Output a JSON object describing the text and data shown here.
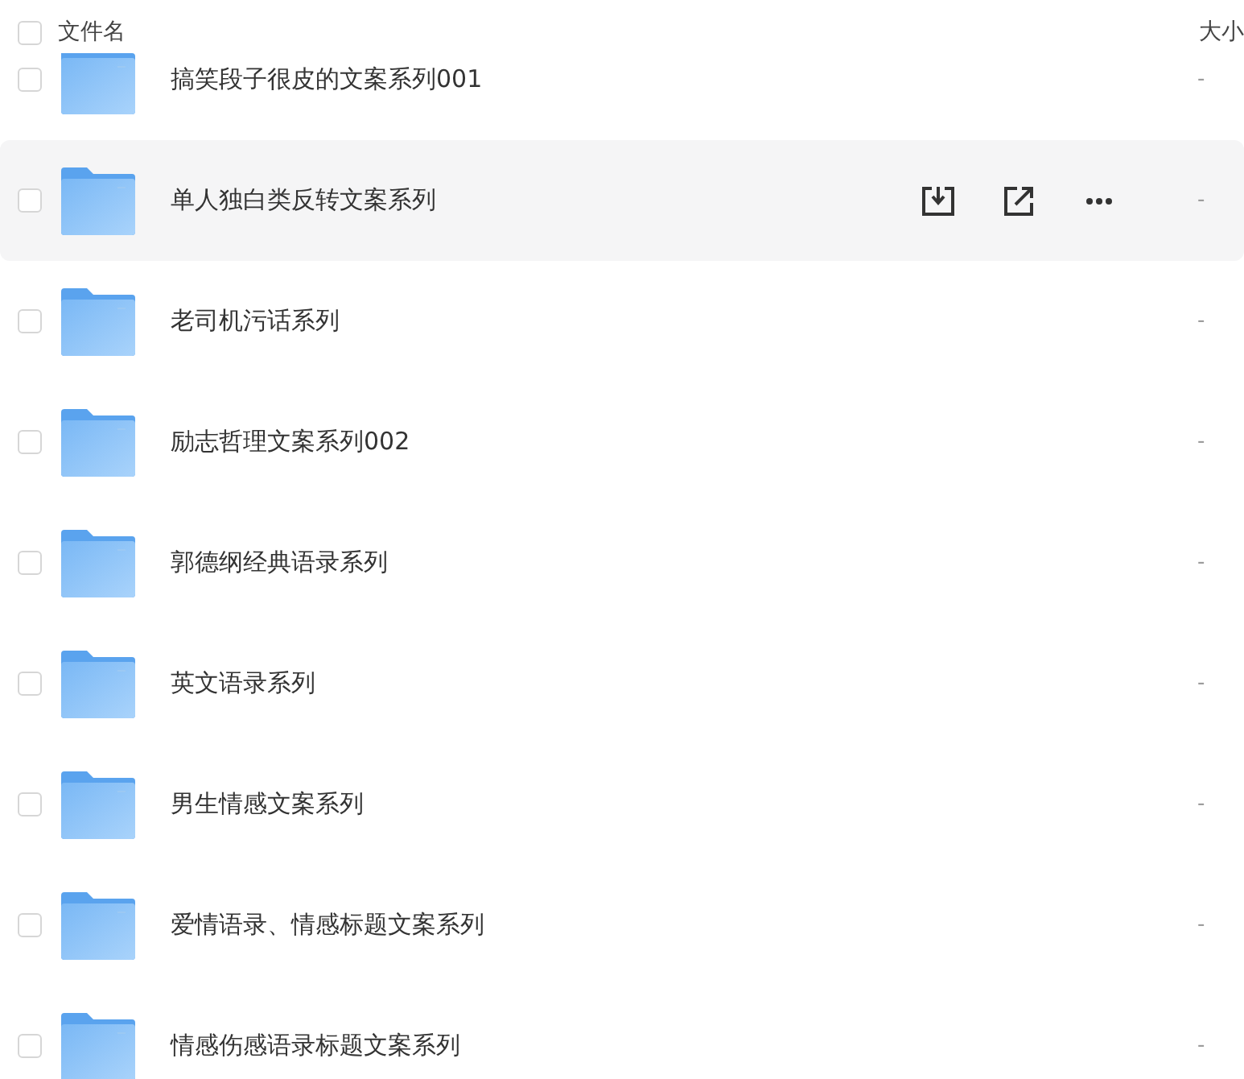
{
  "header": {
    "select_all": {
      "checked": false
    },
    "columns": [
      "文件名",
      "大小"
    ]
  },
  "rows": [
    {
      "name": "搞笑段子很皮的文案系列001",
      "size": "-",
      "checked": false,
      "highlighted": false
    },
    {
      "name": "单人独白类反转文案系列",
      "size": "-",
      "checked": false,
      "highlighted": true
    },
    {
      "name": "老司机污话系列",
      "size": "-",
      "checked": false,
      "highlighted": false
    },
    {
      "name": "励志哲理文案系列002",
      "size": "-",
      "checked": false,
      "highlighted": false
    },
    {
      "name": "郭德纲经典语录系列",
      "size": "-",
      "checked": false,
      "highlighted": false
    },
    {
      "name": "英文语录系列",
      "size": "-",
      "checked": false,
      "highlighted": false
    },
    {
      "name": "男生情感文案系列",
      "size": "-",
      "checked": false,
      "highlighted": false
    },
    {
      "name": "爱情语录、情感标题文案系列",
      "size": "-",
      "checked": false,
      "highlighted": false
    },
    {
      "name": "情感伤感语录标题文案系列",
      "size": "-",
      "checked": false,
      "highlighted": false
    }
  ]
}
